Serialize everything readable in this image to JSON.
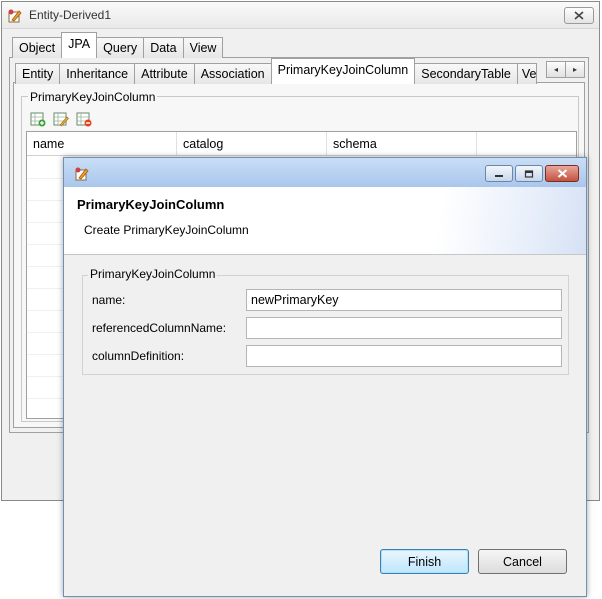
{
  "back_window": {
    "title": "Entity-Derived1",
    "outer_tabs": [
      "Object",
      "JPA",
      "Query",
      "Data",
      "View"
    ],
    "outer_active": 1,
    "inner_tabs": [
      "Entity",
      "Inheritance",
      "Attribute",
      "Association",
      "PrimaryKeyJoinColumn",
      "SecondaryTable",
      "Ve"
    ],
    "inner_active": 4,
    "group_label": "PrimaryKeyJoinColumn",
    "toolbar_icons": [
      "add-row-icon",
      "edit-row-icon",
      "delete-row-icon"
    ],
    "table_columns": [
      "name",
      "catalog",
      "schema"
    ],
    "scroll_left": "◂",
    "scroll_right": "▸"
  },
  "dialog": {
    "title": "PrimaryKeyJoinColumn",
    "subtitle": "Create PrimaryKeyJoinColumn",
    "group_label": "PrimaryKeyJoinColumn",
    "fields": [
      {
        "label": "name:",
        "value": "newPrimaryKey"
      },
      {
        "label": "referencedColumnName:",
        "value": ""
      },
      {
        "label": "columnDefinition:",
        "value": ""
      }
    ],
    "finish_label": "Finish",
    "cancel_label": "Cancel"
  },
  "colors": {
    "dialog_titlebar": "#b6cff0",
    "close_button": "#c8503e",
    "default_button": "#bee6fd"
  }
}
